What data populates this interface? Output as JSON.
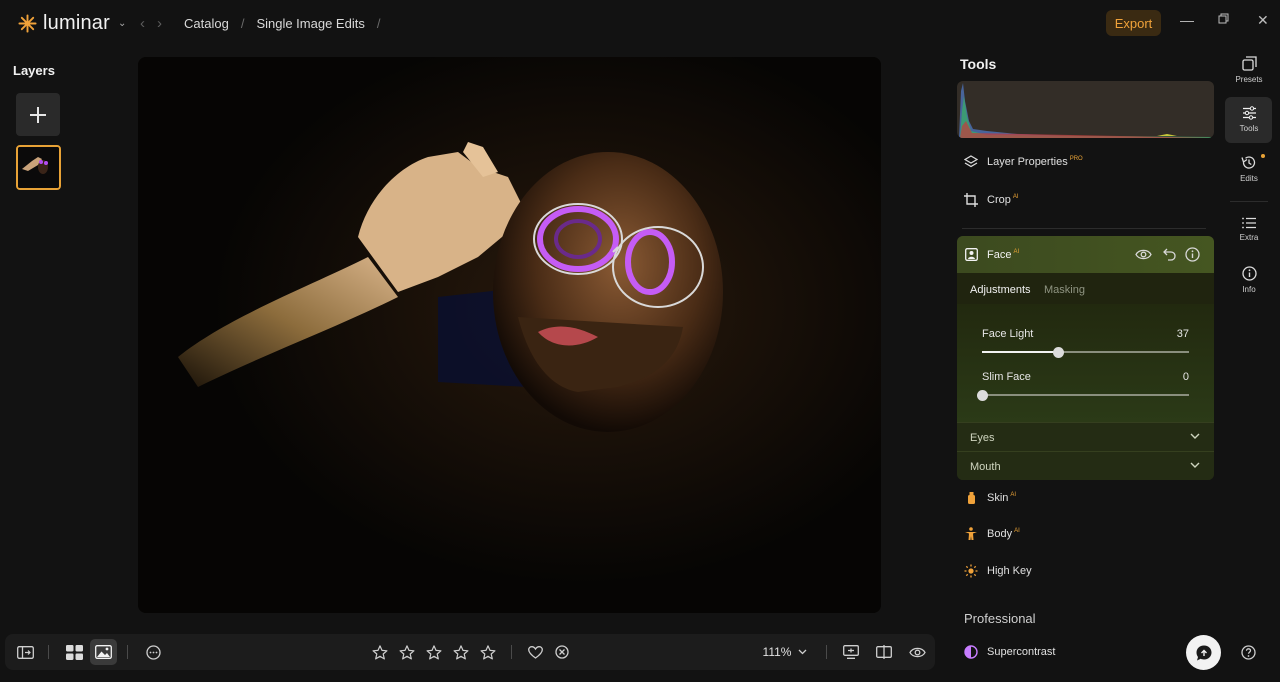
{
  "app": {
    "name": "luminar"
  },
  "breadcrumbs": [
    "Catalog",
    "Single Image Edits"
  ],
  "header": {
    "export_label": "Export"
  },
  "layers": {
    "title": "Layers"
  },
  "tools": {
    "title": "Tools",
    "items": [
      {
        "label": "Layer Properties",
        "badge": "PRO"
      },
      {
        "label": "Crop",
        "badge": "AI"
      }
    ],
    "face": {
      "label": "Face",
      "badge": "AI",
      "tabs": [
        "Adjustments",
        "Masking"
      ],
      "active_tab": "Adjustments",
      "sliders": [
        {
          "label": "Face Light",
          "value": "37",
          "fraction": 0.37
        },
        {
          "label": "Slim Face",
          "value": "0",
          "fraction": 0.0
        }
      ],
      "subsections": [
        "Eyes",
        "Mouth"
      ]
    },
    "more_items": [
      {
        "label": "Skin",
        "badge": "AI",
        "color": "#f0a23a"
      },
      {
        "label": "Body",
        "badge": "AI",
        "color": "#f0a23a"
      },
      {
        "label": "High Key",
        "badge": "",
        "color": "#f0a23a"
      }
    ],
    "professional": {
      "title": "Professional",
      "items": [
        {
          "label": "Supercontrast",
          "color": "#c77dff"
        }
      ]
    }
  },
  "right_strip": [
    {
      "label": "Presets",
      "icon": "presets-icon"
    },
    {
      "label": "Tools",
      "icon": "sliders-icon",
      "active": true
    },
    {
      "label": "Edits",
      "icon": "history-icon"
    },
    {
      "label": "Extra",
      "icon": "list-icon"
    },
    {
      "label": "Info",
      "icon": "info-icon"
    }
  ],
  "bottom_toolbar": {
    "zoom": "111%",
    "rating": 0,
    "max_rating": 5
  },
  "colors": {
    "accent": "#e8a236",
    "face_panel": "#3c4a1f",
    "background": "#121212"
  }
}
